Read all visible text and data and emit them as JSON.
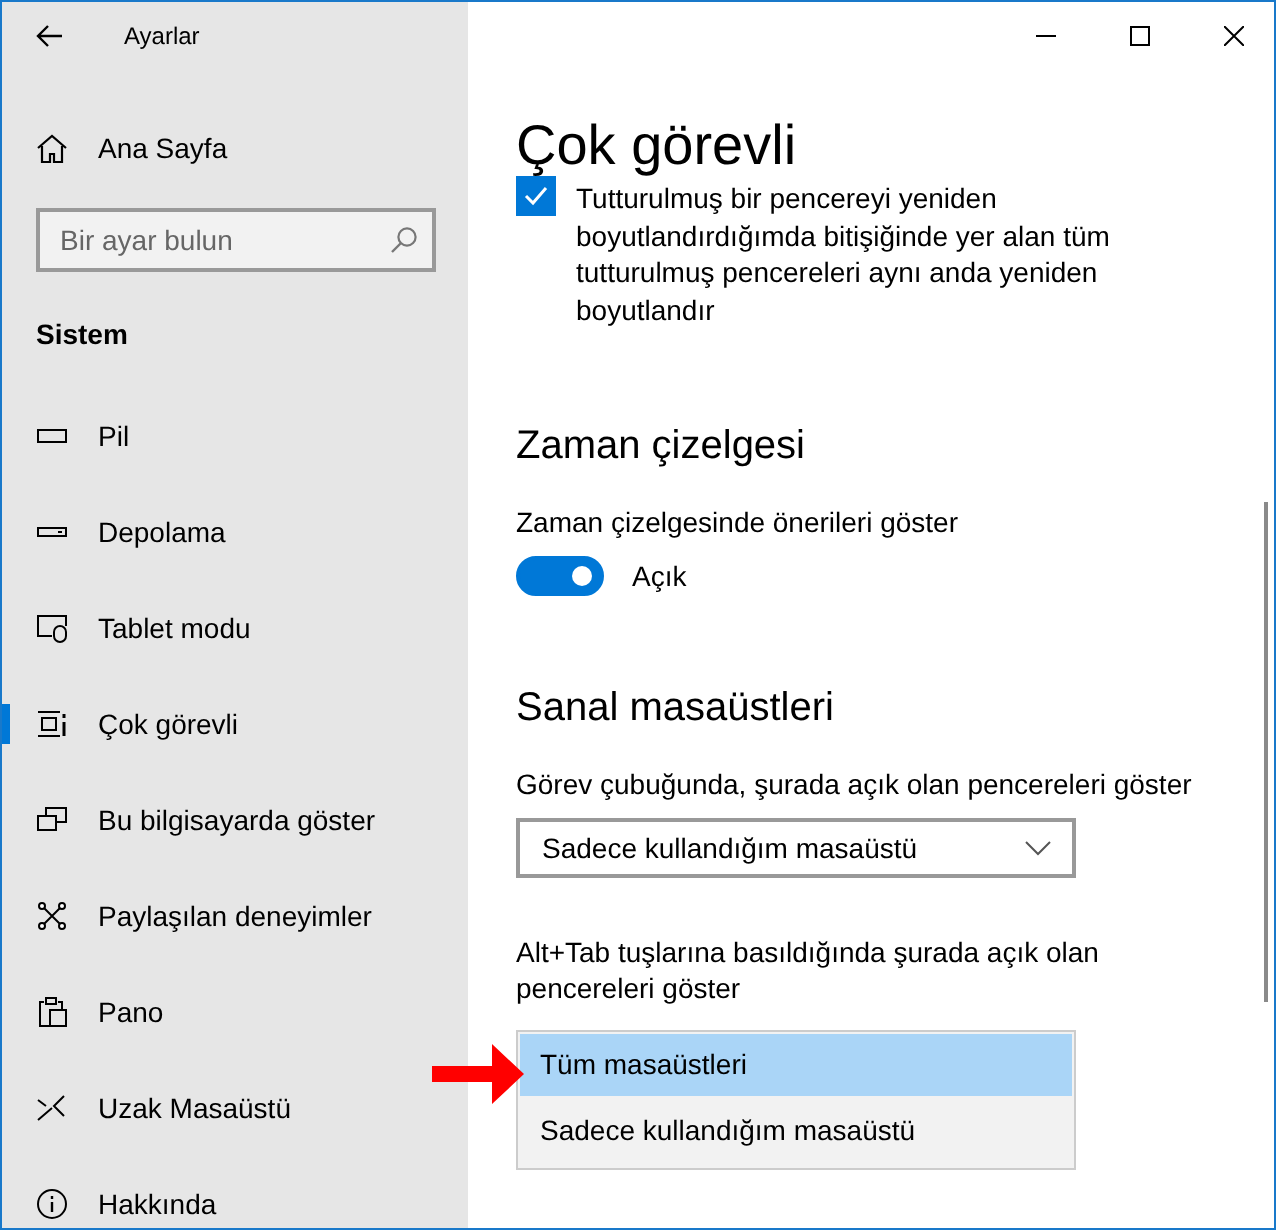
{
  "window": {
    "title": "Ayarlar"
  },
  "sidebar": {
    "home": "Ana Sayfa",
    "search": {
      "placeholder": "Bir ayar bulun"
    },
    "section": "Sistem",
    "items": [
      {
        "label": "Pil",
        "selected": false
      },
      {
        "label": "Depolama",
        "selected": false
      },
      {
        "label": "Tablet modu",
        "selected": false
      },
      {
        "label": "Çok görevli",
        "selected": true
      },
      {
        "label": "Bu bilgisayarda göster",
        "selected": false
      },
      {
        "label": "Paylaşılan deneyimler",
        "selected": false
      },
      {
        "label": "Pano",
        "selected": false
      },
      {
        "label": "Uzak Masaüstü",
        "selected": false
      },
      {
        "label": "Hakkında",
        "selected": false
      }
    ]
  },
  "page": {
    "title": "Çok görevli",
    "snap_option": {
      "label": "Tutturulmuş bir pencereyi yeniden boyutlandırdığımda bitişiğinde yer alan tüm tutturulmuş pencereleri aynı anda yeniden boyutlandır",
      "checked": true
    },
    "timeline": {
      "heading": "Zaman çizelgesi",
      "label": "Zaman çizelgesinde önerileri göster",
      "on": true,
      "state": "Açık"
    },
    "desktops": {
      "heading": "Sanal masaüstleri",
      "taskbar": {
        "label": "Görev çubuğunda, şurada açık olan pencereleri göster",
        "value": "Sadece kullandığım masaüstü"
      },
      "alttab": {
        "label": "Alt+Tab tuşlarına basıldığında şurada açık olan pencereleri göster",
        "options": [
          {
            "label": "Tüm masaüstleri",
            "selected": true
          },
          {
            "label": "Sadece kullandığım masaüstü",
            "selected": false
          }
        ]
      }
    }
  }
}
